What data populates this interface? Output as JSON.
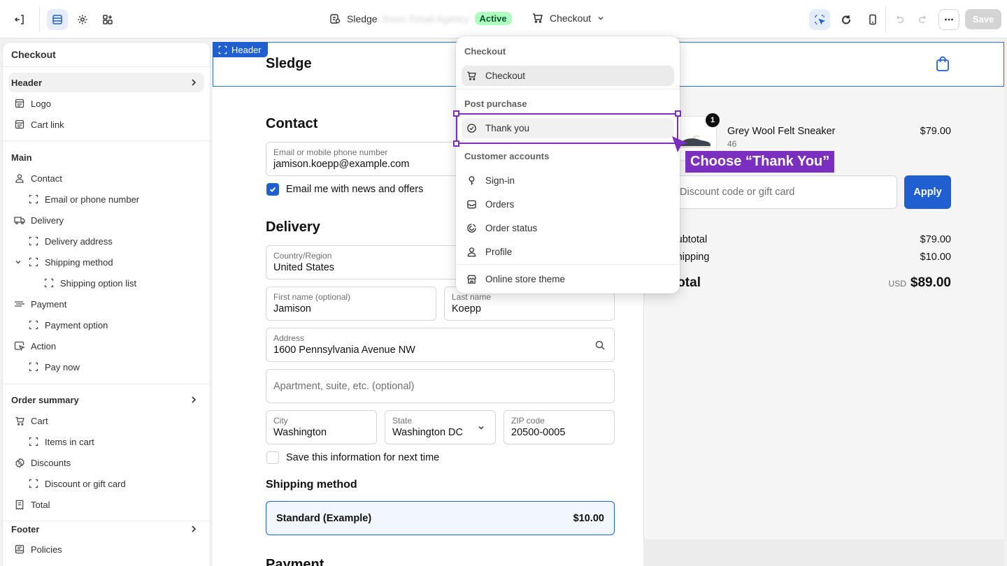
{
  "topbar": {
    "store_name": "Sledge",
    "store_blurred": "Basic Email Agency",
    "status_badge": "Active",
    "page_select": "Checkout",
    "save_label": "Save"
  },
  "sidebar": {
    "title": "Checkout",
    "header_section": "Header",
    "logo": "Logo",
    "cart_link": "Cart link",
    "main_section": "Main",
    "contact": "Contact",
    "email_or_phone": "Email or phone number",
    "delivery": "Delivery",
    "delivery_address": "Delivery address",
    "shipping_method": "Shipping method",
    "shipping_option_list": "Shipping option list",
    "payment": "Payment",
    "payment_option": "Payment option",
    "action": "Action",
    "pay_now": "Pay now",
    "order_summary": "Order summary",
    "cart": "Cart",
    "items_in_cart": "Items in cart",
    "discounts": "Discounts",
    "discount_or_gift_card": "Discount or gift card",
    "total": "Total",
    "footer": "Footer",
    "policies": "Policies"
  },
  "preview": {
    "header_tag": "Header",
    "shop_name": "Sledge",
    "contact_heading": "Contact",
    "email_label": "Email or mobile phone number",
    "email_value": "jamison.koepp@example.com",
    "email_news": "Email me with news and offers",
    "delivery_heading": "Delivery",
    "country_label": "Country/Region",
    "country_value": "United States",
    "first_name_label": "First name (optional)",
    "first_name_value": "Jamison",
    "last_name_label": "Last name",
    "last_name_value": "Koepp",
    "address_label": "Address",
    "address_value": "1600 Pennsylvania Avenue NW",
    "apartment_placeholder": "Apartment, suite, etc. (optional)",
    "city_label": "City",
    "city_value": "Washington",
    "state_label": "State",
    "state_value": "Washington DC",
    "zip_label": "ZIP code",
    "zip_value": "20500-0005",
    "save_info": "Save this information for next time",
    "shipping_method_heading": "Shipping method",
    "shipping_option_name": "Standard (Example)",
    "shipping_option_price": "$10.00",
    "payment_heading": "Payment"
  },
  "summary": {
    "quantity": "1",
    "product_name": "Grey Wool Felt Sneaker",
    "product_variant": "46",
    "product_price": "$79.00",
    "discount_placeholder": "Discount code or gift card",
    "apply_label": "Apply",
    "subtotal_label": "Subtotal",
    "subtotal_value": "$79.00",
    "shipping_label": "Shipping",
    "shipping_value": "$10.00",
    "total_label": "Total",
    "currency": "USD",
    "total_value": "$89.00"
  },
  "dropdown": {
    "group_checkout": "Checkout",
    "item_checkout": "Checkout",
    "group_post_purchase": "Post purchase",
    "item_thank_you": "Thank you",
    "group_customer_accounts": "Customer accounts",
    "item_sign_in": "Sign-in",
    "item_orders": "Orders",
    "item_order_status": "Order status",
    "item_profile": "Profile",
    "item_online_store_theme": "Online store theme"
  },
  "annotation": {
    "label": "Choose “Thank You”",
    "color": "#7b2fbe"
  },
  "colors": {
    "accent": "#1f5fcf",
    "active_badge_bg": "#affebf",
    "active_badge_text": "#0c5132"
  }
}
